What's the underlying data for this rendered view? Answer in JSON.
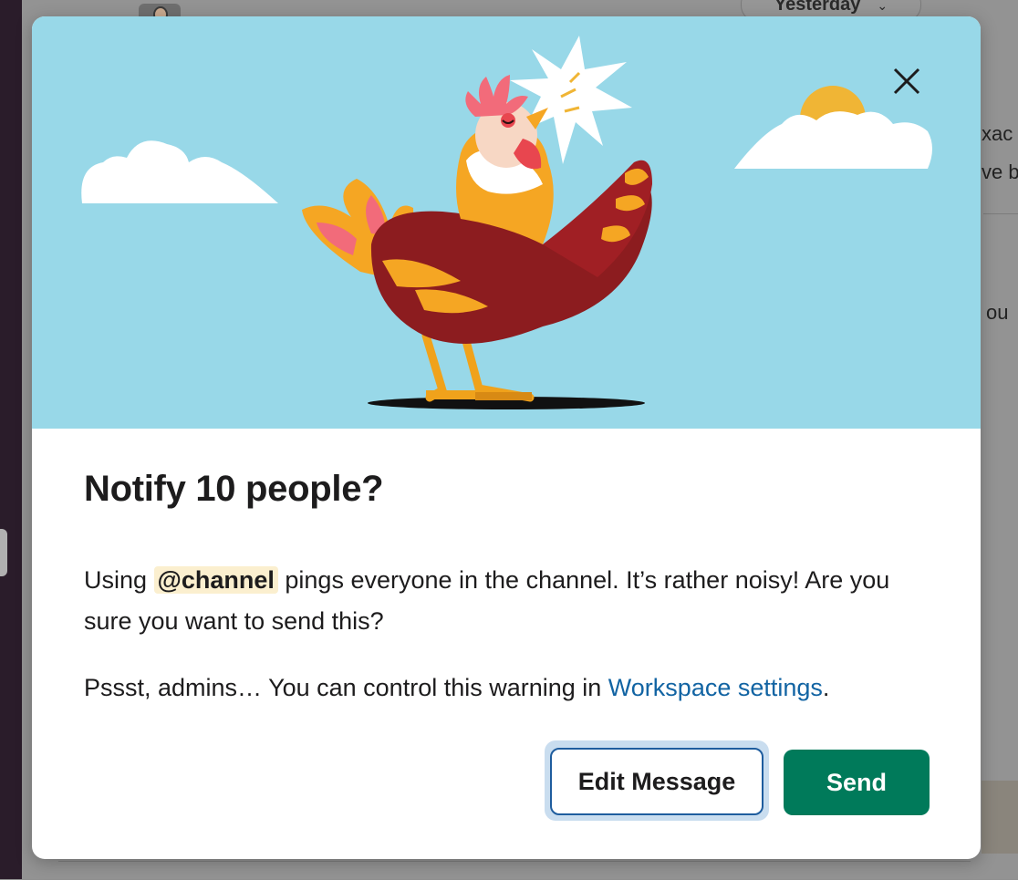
{
  "background": {
    "date_pill": {
      "label": "Yesterday",
      "caret": "⌄"
    },
    "partial_text": [
      "xac",
      "ve b",
      "l  ou"
    ]
  },
  "modal": {
    "close_icon": "close-icon",
    "title": "Notify 10 people?",
    "body": {
      "before_mention": "Using ",
      "mention": "@channel",
      "after_mention": " pings everyone in the channel. It’s rather noisy! Are you sure you want to send this?"
    },
    "admin_note": {
      "text": "Pssst, admins… You can control this warning in ",
      "link": "Workspace settings",
      "suffix": "."
    },
    "buttons": {
      "edit": "Edit Message",
      "send": "Send"
    }
  },
  "colors": {
    "hero_bg": "#98d8e8",
    "send_button": "#007a5a",
    "link": "#1264a3",
    "mention_bg": "#fbefcf"
  }
}
